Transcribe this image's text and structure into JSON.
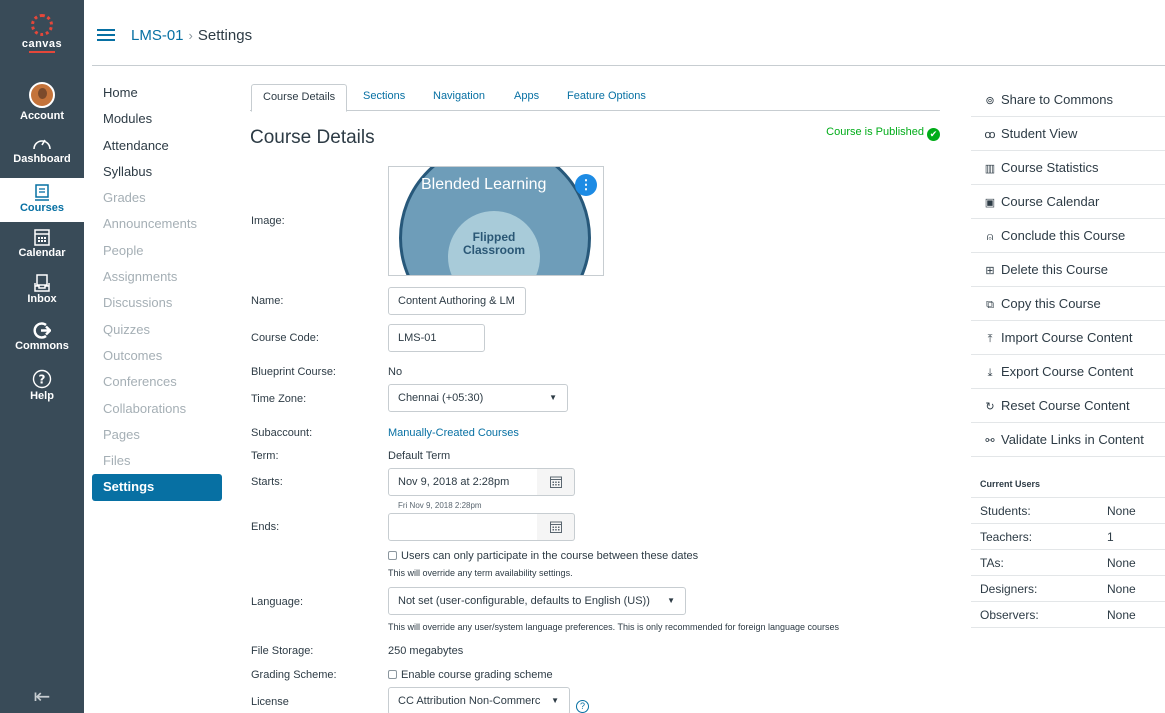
{
  "global_nav": {
    "logo_text": "canvas",
    "items": [
      {
        "label": "Account"
      },
      {
        "label": "Dashboard"
      },
      {
        "label": "Courses"
      },
      {
        "label": "Calendar"
      },
      {
        "label": "Inbox"
      },
      {
        "label": "Commons"
      },
      {
        "label": "Help"
      }
    ],
    "active": "Courses"
  },
  "breadcrumb": {
    "course": "LMS-01",
    "current": "Settings"
  },
  "course_nav": {
    "items": [
      {
        "label": "Home",
        "hidden": false
      },
      {
        "label": "Modules",
        "hidden": false
      },
      {
        "label": "Attendance",
        "hidden": false
      },
      {
        "label": "Syllabus",
        "hidden": false
      },
      {
        "label": "Grades",
        "hidden": true
      },
      {
        "label": "Announcements",
        "hidden": true
      },
      {
        "label": "People",
        "hidden": true
      },
      {
        "label": "Assignments",
        "hidden": true
      },
      {
        "label": "Discussions",
        "hidden": true
      },
      {
        "label": "Quizzes",
        "hidden": true
      },
      {
        "label": "Outcomes",
        "hidden": true
      },
      {
        "label": "Conferences",
        "hidden": true
      },
      {
        "label": "Collaborations",
        "hidden": true
      },
      {
        "label": "Pages",
        "hidden": true
      },
      {
        "label": "Files",
        "hidden": true
      },
      {
        "label": "Settings",
        "hidden": false
      }
    ],
    "active": "Settings"
  },
  "tabs": [
    "Course Details",
    "Sections",
    "Navigation",
    "Apps",
    "Feature Options"
  ],
  "main": {
    "heading": "Course Details",
    "published": "Course is Published",
    "image": {
      "label": "Image:",
      "outer_text": "Blended Learning",
      "inner_text_1": "Flipped",
      "inner_text_2": "Classroom"
    },
    "name": {
      "label": "Name:",
      "value": "Content Authoring & LM"
    },
    "course_code": {
      "label": "Course Code:",
      "value": "LMS-01"
    },
    "blueprint": {
      "label": "Blueprint Course:",
      "value": "No"
    },
    "time_zone": {
      "label": "Time Zone:",
      "value": "Chennai (+05:30)"
    },
    "subaccount": {
      "label": "Subaccount:",
      "value": "Manually-Created Courses"
    },
    "term": {
      "label": "Term:",
      "value": "Default Term"
    },
    "starts": {
      "label": "Starts:",
      "value": "Nov 9, 2018 at  2:28pm",
      "hint": "Fri Nov 9, 2018 2:28pm"
    },
    "ends": {
      "label": "Ends:",
      "value": ""
    },
    "restrict": {
      "label": "Users can only participate in the course between these dates",
      "note": "This will override any term availability settings."
    },
    "language": {
      "label": "Language:",
      "value": "Not set (user-configurable, defaults to English (US))",
      "note": "This will override any user/system language preferences. This is only recommended for foreign language courses"
    },
    "file_storage": {
      "label": "File Storage:",
      "value": "250 megabytes"
    },
    "grading": {
      "label": "Grading Scheme:",
      "value": "Enable course grading scheme"
    },
    "license": {
      "label": "License",
      "value": "CC Attribution Non-Commerc"
    }
  },
  "right_actions": [
    {
      "icon": "share-icon",
      "glyph": "⊚",
      "label": "Share to Commons"
    },
    {
      "icon": "glasses-icon",
      "glyph": "ꝏ",
      "label": "Student View"
    },
    {
      "icon": "stats-icon",
      "glyph": "▥",
      "label": "Course Statistics"
    },
    {
      "icon": "calendar-icon",
      "glyph": "▣",
      "label": "Course Calendar"
    },
    {
      "icon": "lock-icon",
      "glyph": "⍝",
      "label": "Conclude this Course"
    },
    {
      "icon": "trash-icon",
      "glyph": "⊞",
      "label": "Delete this Course"
    },
    {
      "icon": "copy-icon",
      "glyph": "⧉",
      "label": "Copy this Course"
    },
    {
      "icon": "import-icon",
      "glyph": "⤒",
      "label": "Import Course Content"
    },
    {
      "icon": "export-icon",
      "glyph": "⤓",
      "label": "Export Course Content"
    },
    {
      "icon": "reset-icon",
      "glyph": "↻",
      "label": "Reset Course Content"
    },
    {
      "icon": "link-icon",
      "glyph": "⚯",
      "label": "Validate Links in Content"
    }
  ],
  "current_users": {
    "title": "Current Users",
    "rows": [
      {
        "label": "Students:",
        "value": "None"
      },
      {
        "label": "Teachers:",
        "value": "1"
      },
      {
        "label": "TAs:",
        "value": "None"
      },
      {
        "label": "Designers:",
        "value": "None"
      },
      {
        "label": "Observers:",
        "value": "None"
      }
    ]
  },
  "colors": {
    "nav_bg": "#394b58",
    "link": "#0770a3",
    "published": "#00ac18",
    "text": "#2d3b45"
  }
}
